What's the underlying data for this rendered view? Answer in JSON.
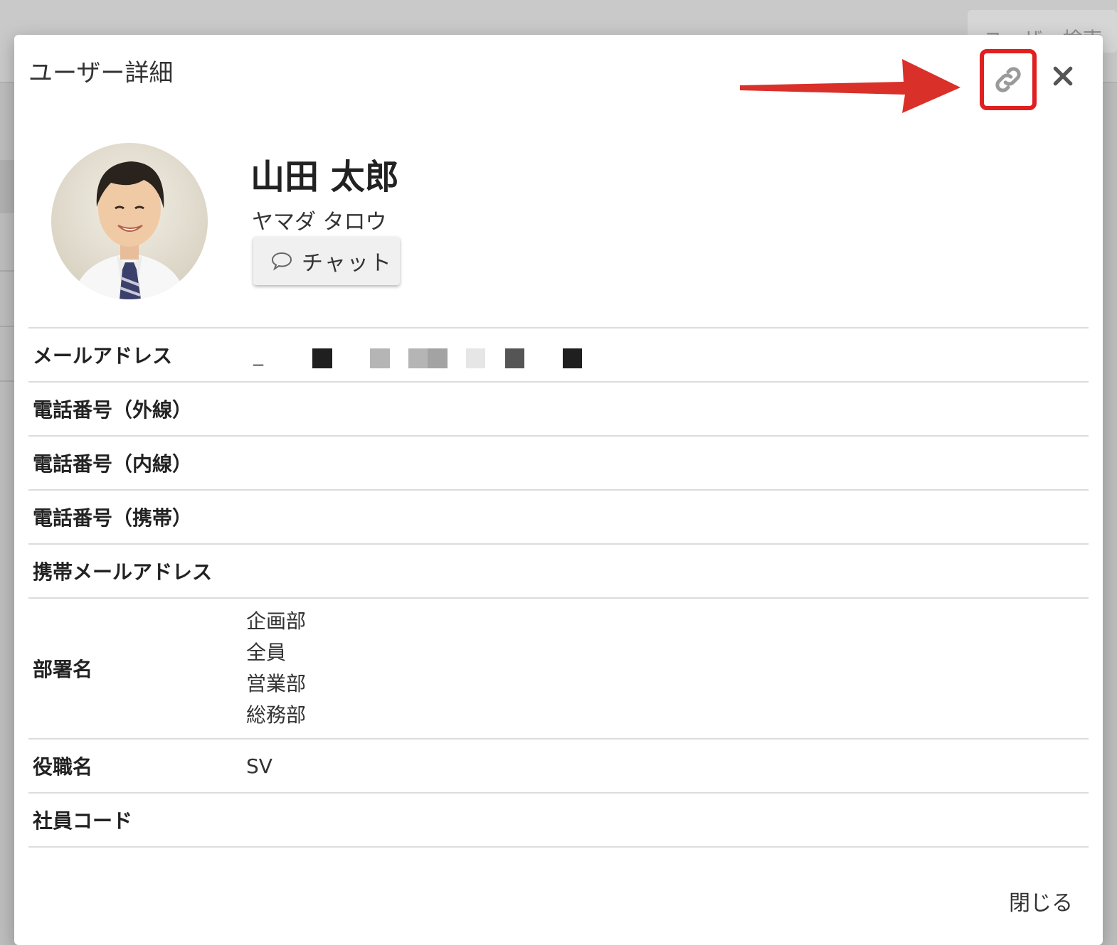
{
  "background": {
    "search_label": "ユーザー検索"
  },
  "modal": {
    "title": "ユーザー詳細",
    "link_icon": "link-icon",
    "close_icon": "close-icon",
    "annotation_color": "#d9302a"
  },
  "user": {
    "name": "山田 太郎",
    "kana": "ヤマダ タロウ",
    "chat_label": "チャット"
  },
  "details": {
    "email_label": "メールアドレス",
    "email_value": "_",
    "phone_external_label": "電話番号（外線）",
    "phone_internal_label": "電話番号（内線）",
    "phone_mobile_label": "電話番号（携帯）",
    "mobile_email_label": "携帯メールアドレス",
    "department_label": "部署名",
    "departments": [
      "企画部",
      "全員",
      "営業部",
      "総務部"
    ],
    "position_label": "役職名",
    "position_value": "SV",
    "employee_code_label": "社員コード"
  },
  "footer": {
    "close_label": "閉じる"
  }
}
